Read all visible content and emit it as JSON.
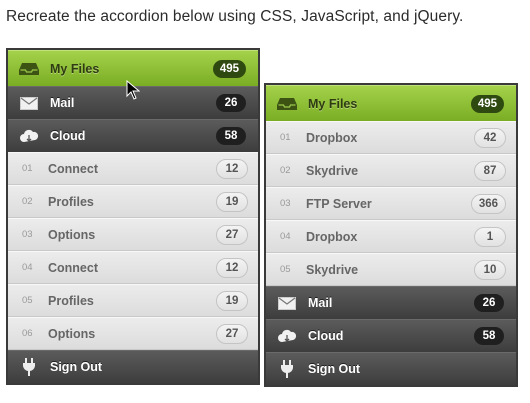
{
  "instruction": "Recreate the accordion below using CSS, JavaScript, and jQuery.",
  "left": {
    "my_files": {
      "label": "My Files",
      "count": "495"
    },
    "mail": {
      "label": "Mail",
      "count": "26"
    },
    "cloud": {
      "label": "Cloud",
      "count": "58"
    },
    "items": [
      {
        "num": "01",
        "label": "Connect",
        "count": "12"
      },
      {
        "num": "02",
        "label": "Profiles",
        "count": "19"
      },
      {
        "num": "03",
        "label": "Options",
        "count": "27"
      },
      {
        "num": "04",
        "label": "Connect",
        "count": "12"
      },
      {
        "num": "05",
        "label": "Profiles",
        "count": "19"
      },
      {
        "num": "06",
        "label": "Options",
        "count": "27"
      }
    ],
    "sign_out": {
      "label": "Sign Out"
    }
  },
  "right": {
    "my_files": {
      "label": "My Files",
      "count": "495"
    },
    "items": [
      {
        "num": "01",
        "label": "Dropbox",
        "count": "42"
      },
      {
        "num": "02",
        "label": "Skydrive",
        "count": "87"
      },
      {
        "num": "03",
        "label": "FTP Server",
        "count": "366"
      },
      {
        "num": "04",
        "label": "Dropbox",
        "count": "1"
      },
      {
        "num": "05",
        "label": "Skydrive",
        "count": "10"
      }
    ],
    "mail": {
      "label": "Mail",
      "count": "26"
    },
    "cloud": {
      "label": "Cloud",
      "count": "58"
    },
    "sign_out": {
      "label": "Sign Out"
    }
  },
  "icons": {
    "my_files": "inbox-tray-icon",
    "mail": "envelope-icon",
    "cloud": "cloud-icon",
    "sign_out": "power-plug-icon"
  },
  "colors": {
    "active_green": "#8dbe35",
    "dark_header": "#4a4a4a",
    "sub_bg": "#e4e4e4"
  }
}
